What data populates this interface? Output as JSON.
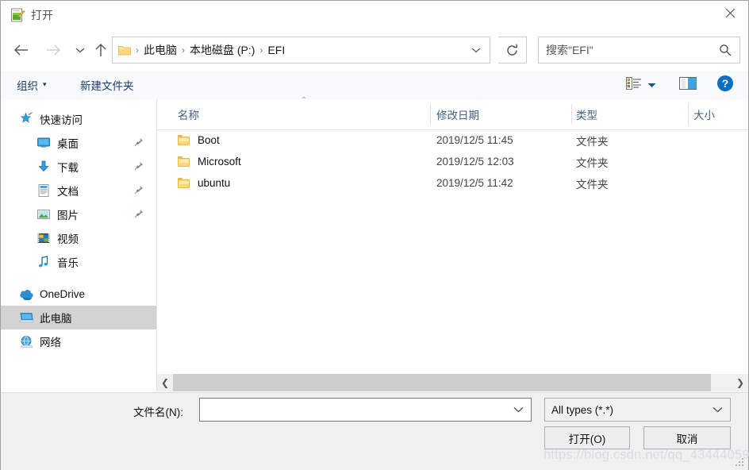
{
  "window": {
    "title": "打开",
    "title_icon": "notepad-edit-icon",
    "close_label": "✕"
  },
  "nav": {
    "back_icon": "arrow-left-icon",
    "forward_icon": "arrow-right-icon",
    "recent_icon": "chevron-down-icon",
    "up_icon": "arrow-up-icon",
    "refresh_icon": "refresh-icon"
  },
  "address": {
    "folder_icon": "folder-icon",
    "crumbs": [
      "此电脑",
      "本地磁盘 (P:)",
      "EFI"
    ],
    "separator": "›",
    "dropdown_icon": "chevron-down-icon"
  },
  "search": {
    "placeholder": "搜索\"EFI\"",
    "icon": "search-icon"
  },
  "toolbar": {
    "organize_label": "组织",
    "organize_caret": "▾",
    "new_folder_label": "新建文件夹",
    "view_icon": "view-list-icon",
    "view_caret": "▾",
    "preview_pane_icon": "preview-pane-icon",
    "help_icon": "help-icon",
    "help_glyph": "?"
  },
  "sidebar": {
    "items": [
      {
        "label": "快速访问",
        "icon": "star-pin-icon",
        "level": 0,
        "pinned": false,
        "selected": false
      },
      {
        "label": "桌面",
        "icon": "desktop-icon",
        "level": 1,
        "pinned": true,
        "selected": false
      },
      {
        "label": "下载",
        "icon": "downloads-icon",
        "level": 1,
        "pinned": true,
        "selected": false
      },
      {
        "label": "文档",
        "icon": "documents-icon",
        "level": 1,
        "pinned": true,
        "selected": false
      },
      {
        "label": "图片",
        "icon": "pictures-icon",
        "level": 1,
        "pinned": true,
        "selected": false
      },
      {
        "label": "视频",
        "icon": "videos-icon",
        "level": 1,
        "pinned": false,
        "selected": false
      },
      {
        "label": "音乐",
        "icon": "music-icon",
        "level": 1,
        "pinned": false,
        "selected": false
      },
      {
        "label": "OneDrive",
        "icon": "onedrive-cloud-icon",
        "level": 0,
        "pinned": false,
        "selected": false
      },
      {
        "label": "此电脑",
        "icon": "this-pc-icon",
        "level": 0,
        "pinned": false,
        "selected": true
      },
      {
        "label": "网络",
        "icon": "network-icon",
        "level": 0,
        "pinned": false,
        "selected": false
      }
    ]
  },
  "filelist": {
    "columns": [
      {
        "label": "名称",
        "sort": "asc"
      },
      {
        "label": "修改日期",
        "sort": ""
      },
      {
        "label": "类型",
        "sort": ""
      },
      {
        "label": "大小",
        "sort": ""
      }
    ],
    "sort_caret": "⌃",
    "rows": [
      {
        "icon": "folder-icon",
        "name": "Boot",
        "date": "2019/12/5 11:45",
        "type": "文件夹",
        "size": ""
      },
      {
        "icon": "folder-icon",
        "name": "Microsoft",
        "date": "2019/12/5 12:03",
        "type": "文件夹",
        "size": ""
      },
      {
        "icon": "folder-icon",
        "name": "ubuntu",
        "date": "2019/12/5 11:42",
        "type": "文件夹",
        "size": ""
      }
    ]
  },
  "hscrollbar": {
    "left_arrow": "❮",
    "right_arrow": "❯"
  },
  "bottom": {
    "filename_label": "文件名(N):",
    "filename_value": "",
    "filename_placeholder": "",
    "filename_chevron": "chevron-down-icon",
    "filetype_value": "All types (*.*)",
    "filetype_chevron": "chevron-down-icon",
    "open_button": "打开(O)",
    "cancel_button": "取消"
  },
  "watermark": {
    "text": "https://blog.csdn.net/qq_43444059"
  },
  "colors": {
    "accent": "#0078d7",
    "header_text": "#45617d",
    "toolbar_link": "#1d3c63",
    "folder_yellow": "#fcd975",
    "selection": "#d3d3d3"
  }
}
